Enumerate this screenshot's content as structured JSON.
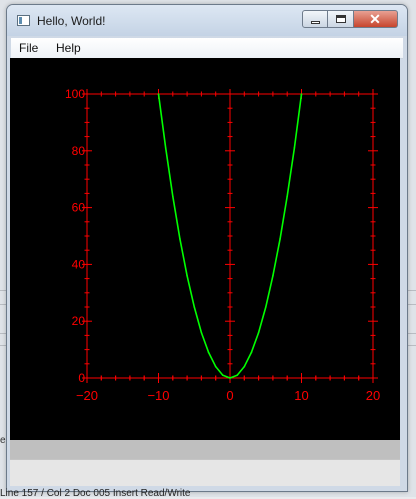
{
  "window": {
    "title": "Hello, World!",
    "menu": [
      "File",
      "Help"
    ],
    "close_glyph": "✕"
  },
  "chart_data": {
    "type": "line",
    "title": "",
    "xlabel": "",
    "ylabel": "",
    "xlim": [
      -20,
      20
    ],
    "ylim": [
      0,
      100
    ],
    "x_ticks": [
      -20,
      -10,
      0,
      10,
      20
    ],
    "x_tick_labels": [
      "−20",
      "−10",
      "0",
      "10",
      "20"
    ],
    "y_ticks": [
      0,
      20,
      40,
      60,
      80,
      100
    ],
    "y_tick_labels": [
      "0",
      "20",
      "40",
      "60",
      "80",
      "100"
    ],
    "grid": false,
    "series": [
      {
        "color": "#00ff00",
        "x": [
          -10,
          -9,
          -8,
          -7,
          -6,
          -5,
          -4,
          -3,
          -2,
          -1,
          0,
          1,
          2,
          3,
          4,
          5,
          6,
          7,
          8,
          9,
          10
        ],
        "y": [
          100,
          81,
          64,
          49,
          36,
          25,
          16,
          9,
          4,
          1,
          0,
          1,
          4,
          9,
          16,
          25,
          36,
          49,
          64,
          81,
          100
        ]
      }
    ],
    "axis_color": "#ff0000",
    "background": "#000000"
  },
  "background_text": {
    "status_line": "Line 157 / Col 2   Doc 005   Insert   Read/Write",
    "side_fragment": "e"
  }
}
